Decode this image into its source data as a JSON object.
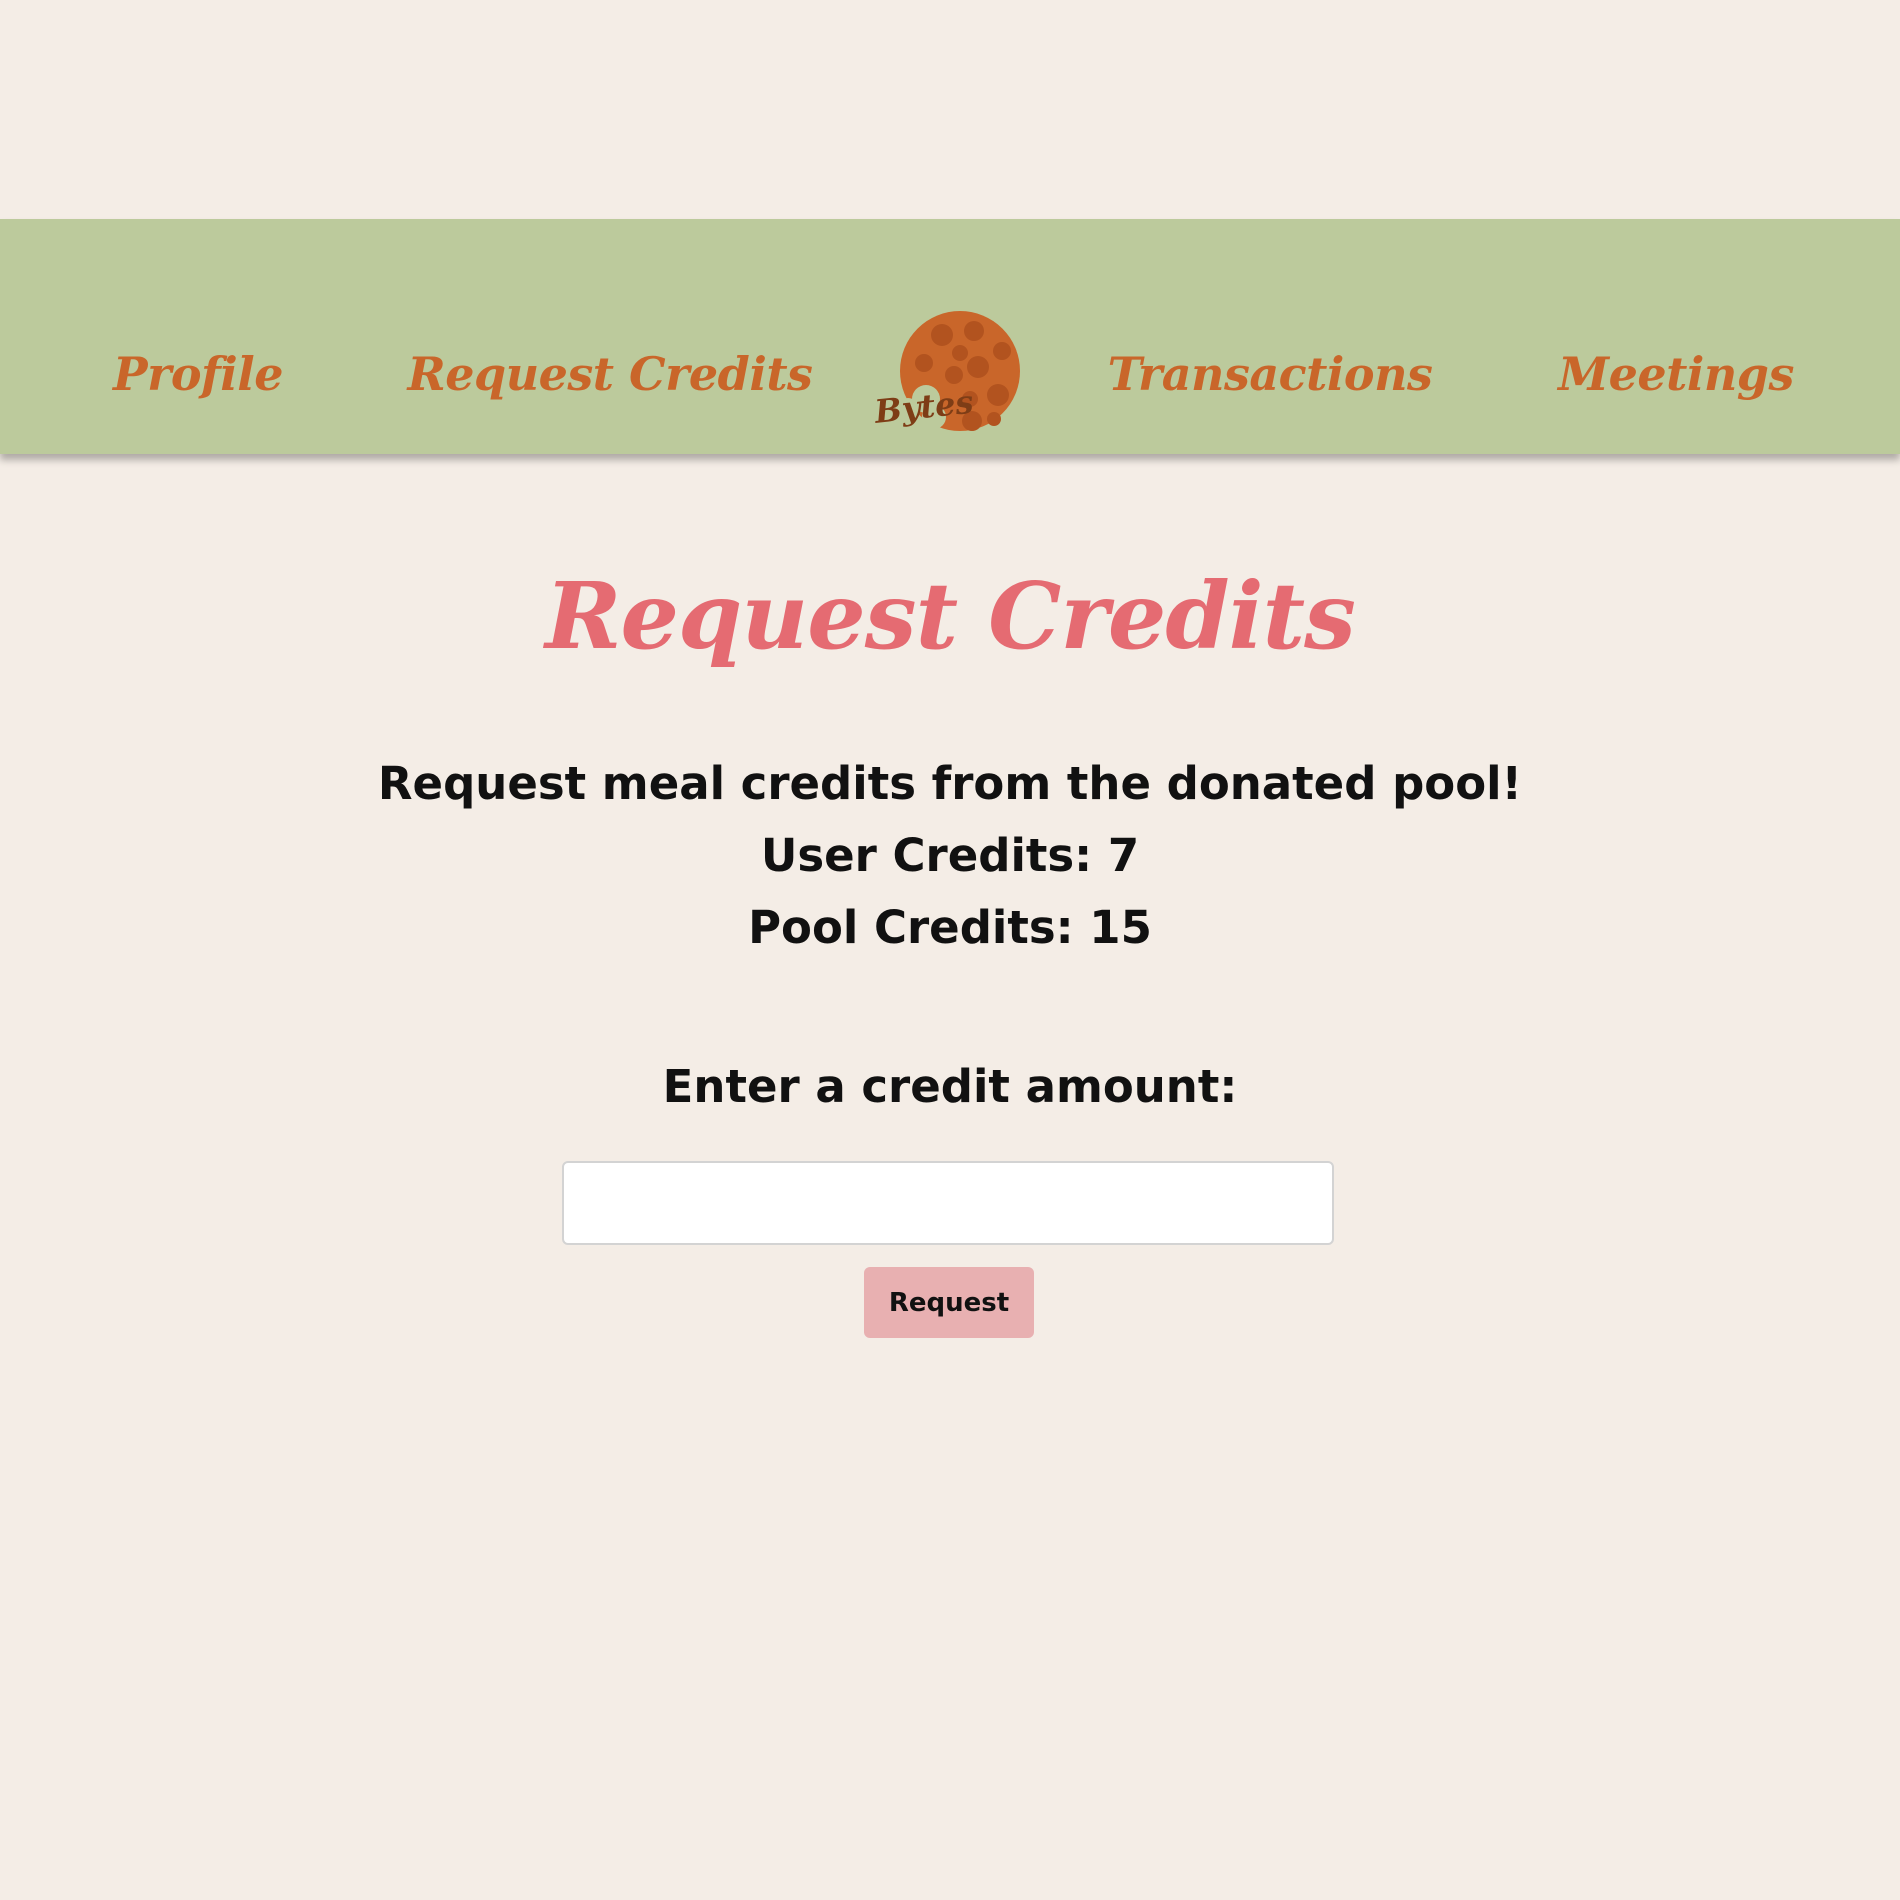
{
  "nav": {
    "items": [
      {
        "label": "Profile"
      },
      {
        "label": "Request Credits"
      },
      {
        "label": "Transactions"
      },
      {
        "label": "Meetings"
      }
    ],
    "logo": {
      "text": "Bytes",
      "icon": "cookie-icon",
      "color": "#c9662a"
    },
    "text_color": "#c9662a",
    "background": "#bcca9c"
  },
  "main": {
    "title": "Request Credits",
    "description": "Request meal credits from the donated pool!",
    "user_credits_text": "User Credits: 7",
    "pool_credits_text": "Pool Credits: 15",
    "amount_label": "Enter a credit amount:",
    "amount_value": "",
    "request_button_label": "Request"
  },
  "colors": {
    "page_background": "#f4ede6",
    "title": "#e56b72",
    "button": "#e8b0b1"
  }
}
